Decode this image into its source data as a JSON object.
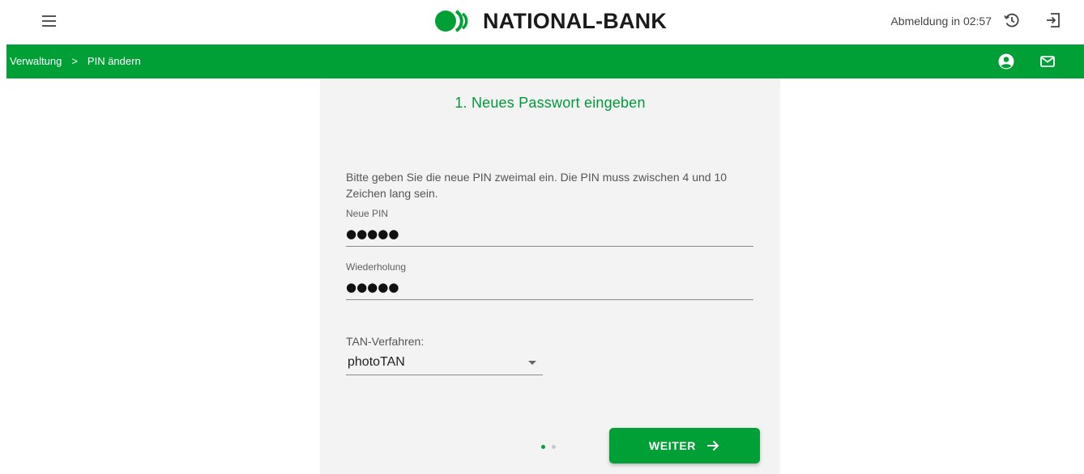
{
  "header": {
    "brand": "NATIONAL-BANK",
    "logout_timer": "Abmeldung in 02:57",
    "brand_color": "#00a037"
  },
  "navbar": {
    "breadcrumb": [
      "Verwaltung",
      ">",
      "PIN ändern"
    ]
  },
  "form": {
    "title": "1. Neues Passwort eingeben",
    "intro": "Bitte geben Sie die neue PIN zweimal ein. Die PIN muss zwischen 4 und 10 Zeichen lang sein.",
    "pin_label": "Neue PIN",
    "pin_value": "●●●●●",
    "repeat_label": "Wiederholung",
    "repeat_value": "●●●●●",
    "tan_label": "TAN-Verfahren:",
    "tan_selected": "photoTAN",
    "next_label": "WEITER",
    "pager": {
      "current": 1,
      "total": 2
    }
  },
  "icons": {
    "menu": "hamburger-icon",
    "history": "history-icon",
    "logout": "exit-icon",
    "user": "user-icon",
    "mail": "mail-icon",
    "next": "arrow-right-icon"
  }
}
